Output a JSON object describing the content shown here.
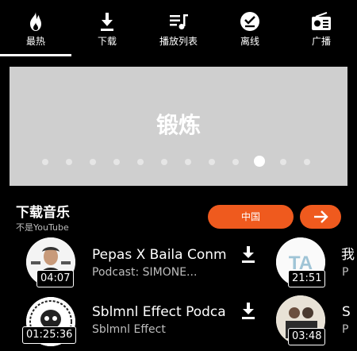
{
  "tabs": [
    {
      "label": "最热",
      "icon": "flame-icon",
      "active": true
    },
    {
      "label": "下载",
      "icon": "download-icon"
    },
    {
      "label": "播放列表",
      "icon": "playlist-icon"
    },
    {
      "label": "离线",
      "icon": "offline-icon"
    },
    {
      "label": "广播",
      "icon": "radio-icon"
    }
  ],
  "banner": {
    "title": "锻炼",
    "dot_count": 12,
    "active_dot_index": 9
  },
  "section": {
    "title": "下载音乐",
    "subtitle": "不是YouTube",
    "region_label": "中国"
  },
  "rows": [
    {
      "title": "Pepas X Baila Conm...",
      "subtitle": "Podcast: SIMONE...",
      "duration": "04:07",
      "right_duration": "21:51",
      "right_glyph": "我",
      "right_sub": "P"
    },
    {
      "title": "Sblmnl Effect Podca...",
      "subtitle": "Sblmnl Effect",
      "duration": "01:25:36",
      "right_duration": "03:48",
      "right_glyph": "S",
      "right_sub": "P"
    }
  ],
  "colors": {
    "accent": "#ef5a1e",
    "banner": "#cfcfcf",
    "background": "#000000"
  }
}
